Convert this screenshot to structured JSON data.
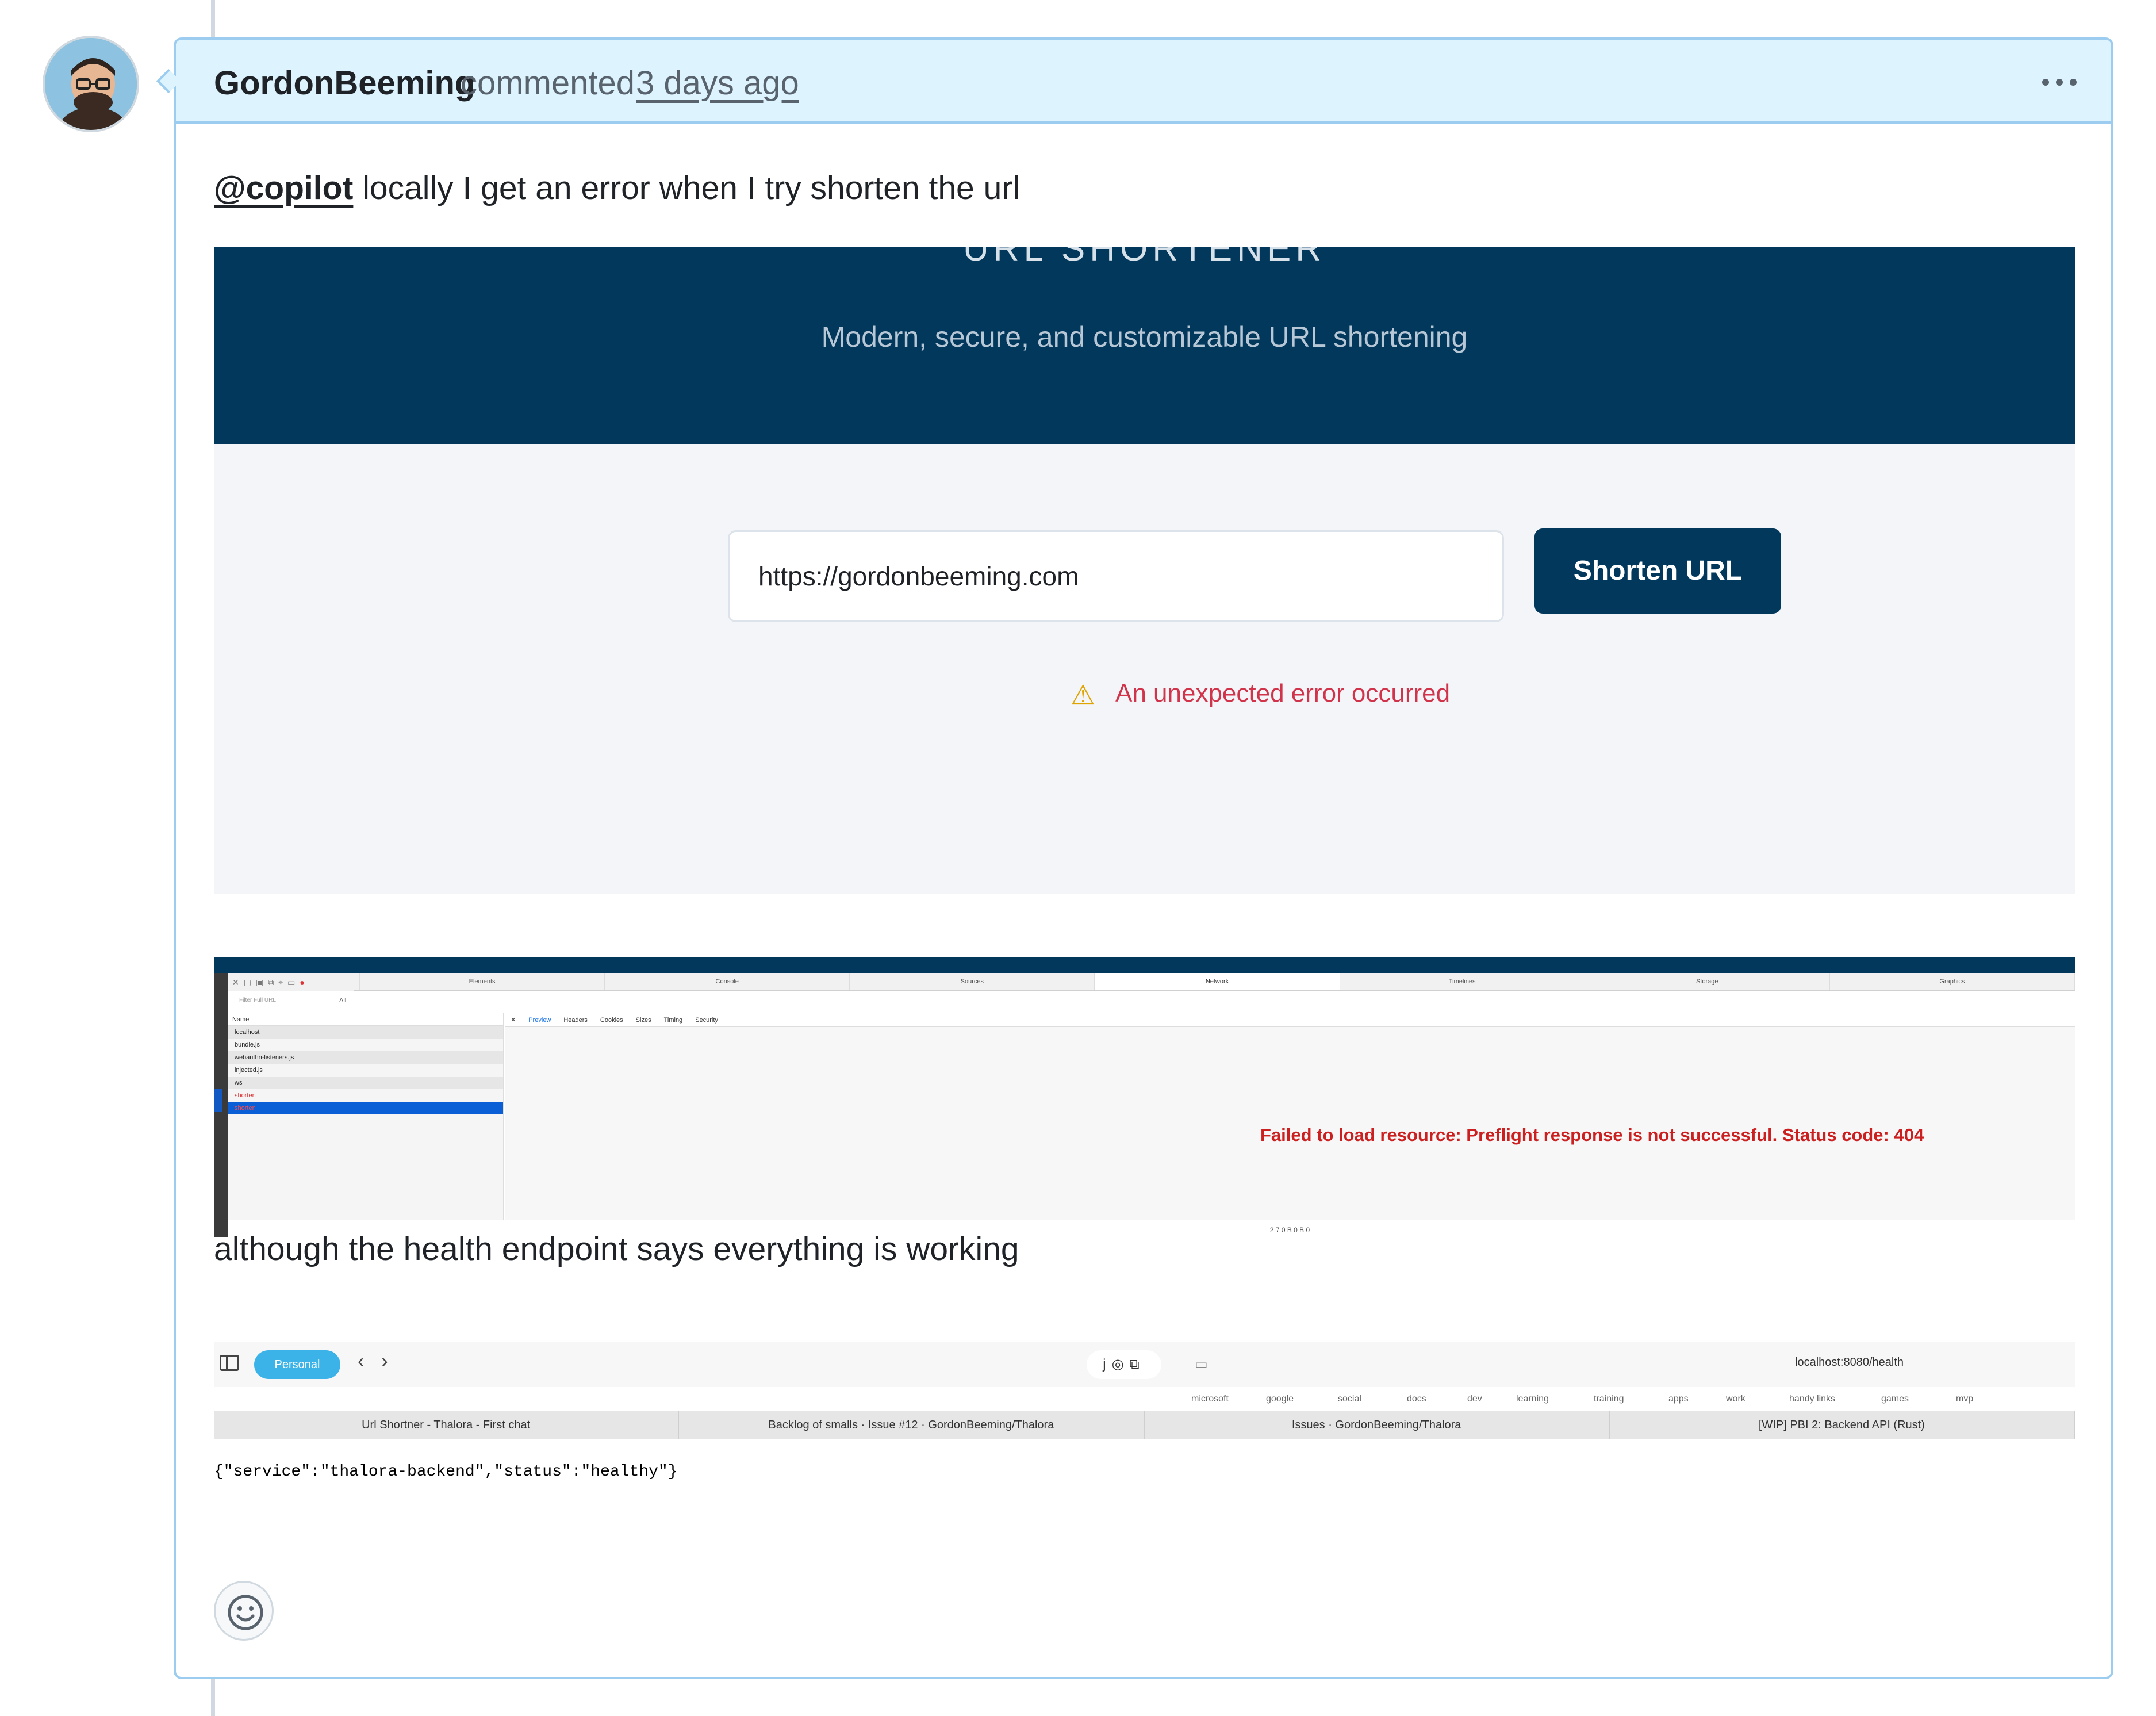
{
  "comment": {
    "author": "GordonBeeming",
    "action": "commented",
    "time_ago": "3 days ago",
    "more_icon": "kebab-horizontal-icon"
  },
  "body": {
    "mention": "@copilot",
    "intro_text": " locally I get an error when I try shorten the url",
    "middle_text": "although the health endpoint says everything is working"
  },
  "app_screenshot": {
    "hero_title": "URL SHORTENER",
    "hero_subtitle": "Modern, secure, and customizable URL shortening",
    "url_value": "https://gordonbeeming.com",
    "shorten_button": "Shorten URL",
    "error_icon": "warning-icon",
    "error_message": "An unexpected error occurred",
    "colors": {
      "hero": "#02385c",
      "error": "#d1344a"
    }
  },
  "devtools_screenshot": {
    "tabs": [
      "Elements",
      "Console",
      "Sources",
      "Network",
      "Timelines",
      "Storage",
      "Graphics"
    ],
    "active_tab": "Network",
    "filter_placeholder": "Filter Full URL",
    "filter_type": "All",
    "list_header": "Name",
    "requests": [
      "localhost",
      "bundle.js",
      "webauthn-listeners.js",
      "injected.js",
      "ws",
      "shorten",
      "shorten"
    ],
    "detail_tabs": [
      "Preview",
      "Headers",
      "Cookies",
      "Sizes",
      "Timing",
      "Security"
    ],
    "error": "Failed to load resource: Preflight response is not successful. Status code: 404",
    "status_bar": "2   7   0 B   0 B   0"
  },
  "browser_screenshot": {
    "profile": "Personal",
    "url": "localhost:8080/health",
    "bookmarks": [
      "microsoft",
      "google",
      "social",
      "docs",
      "dev",
      "learning",
      "training",
      "apps",
      "work",
      "handy links",
      "games",
      "mvp"
    ],
    "tabs": [
      "Url Shortner - Thalora - First chat",
      "Backlog of smalls · Issue #12 · GordonBeeming/Thalora",
      "Issues · GordonBeeming/Thalora",
      "[WIP] PBI 2: Backend API (Rust)"
    ],
    "response": "{\"service\":\"thalora-backend\",\"status\":\"healthy\"}"
  },
  "reaction_icon": "smiley-icon"
}
